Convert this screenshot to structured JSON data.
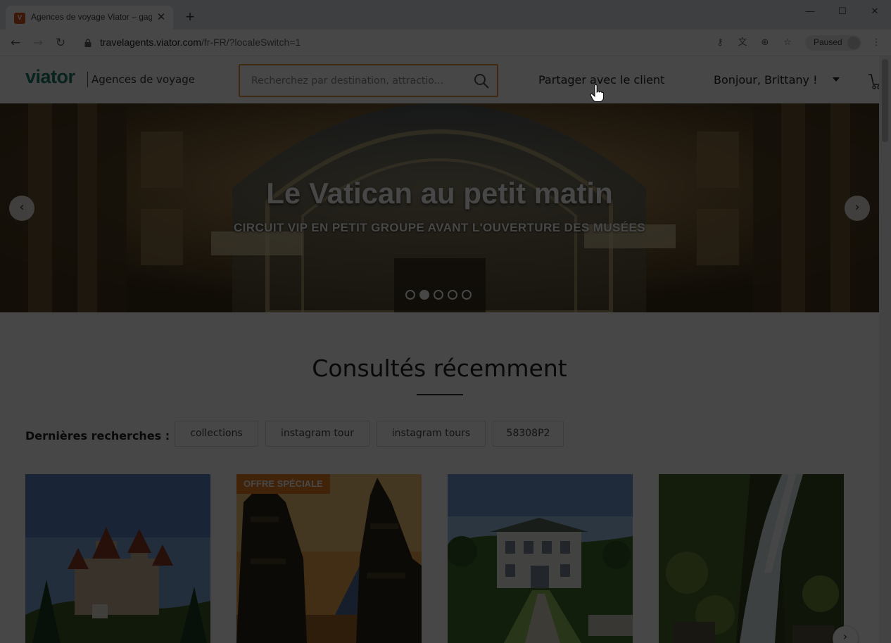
{
  "browser": {
    "tab_title": "Agences de voyage Viator – gagnez",
    "favicon_letter": "V",
    "url_host": "travelagents.viator.com",
    "url_path": "/fr-FR/?localeSwitch=1",
    "profile_status": "Paused"
  },
  "header": {
    "logo": "viator",
    "agency_label": "Agences de voyage",
    "search_placeholder": "Recherchez par destination, attractio...",
    "share_label": "Partager avec le client",
    "greeting": "Bonjour, Brittany !"
  },
  "hero": {
    "title": "Le Vatican au petit matin",
    "subtitle": "CIRCUIT VIP EN PETIT GROUPE AVANT L'OUVERTURE DES MUSÉES",
    "slide_count": 5,
    "active_slide": 2
  },
  "recent": {
    "title": "Consultés récemment",
    "searches_label": "Dernières recherches :",
    "chips": [
      "collections",
      "instagram tour",
      "instagram tours",
      "58308P2"
    ],
    "cards": [
      {
        "badge": "",
        "icon": "castle-photo"
      },
      {
        "badge": "OFFRE SPÉCIALE",
        "icon": "temple-gate-photo"
      },
      {
        "badge": "",
        "icon": "mansion-photo"
      },
      {
        "badge": "",
        "icon": "waterfall-photo"
      }
    ]
  },
  "colors": {
    "brand": "#1d7a6e",
    "search_border": "#e2943b",
    "badge": "#e67e22",
    "overlay": "rgba(0,0,0,0.72)"
  }
}
